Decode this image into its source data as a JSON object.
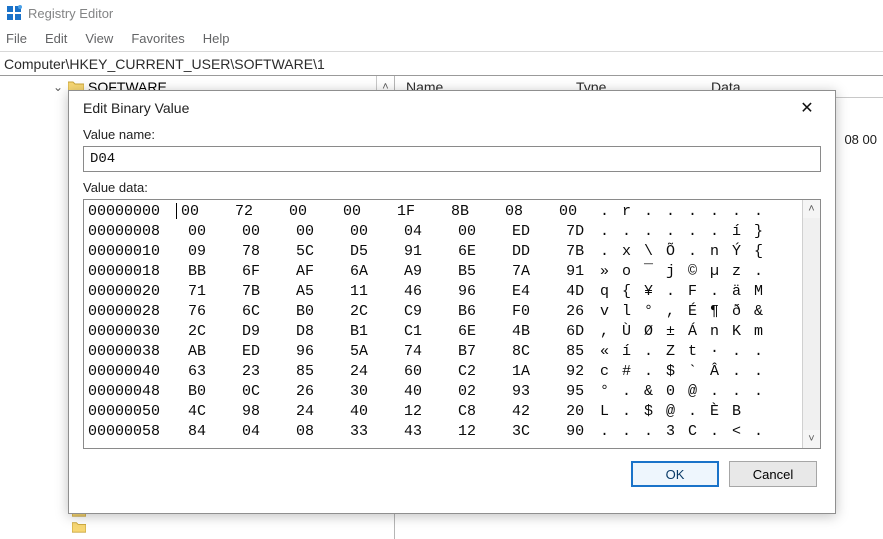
{
  "app": {
    "title": "Registry Editor"
  },
  "menu": {
    "file": "File",
    "edit": "Edit",
    "view": "View",
    "favorites": "Favorites",
    "help": "Help"
  },
  "address": {
    "path": "Computer\\HKEY_CURRENT_USER\\SOFTWARE\\1"
  },
  "tree": {
    "selected_label": "SOFTWARE"
  },
  "list": {
    "col_name": "Name",
    "col_type": "Type",
    "col_data": "Data",
    "extra_data": "08 00"
  },
  "dialog": {
    "title": "Edit Binary Value",
    "value_name_label": "Value name:",
    "value_name": "D04",
    "value_data_label": "Value data:",
    "ok": "OK",
    "cancel": "Cancel",
    "hex_rows": [
      {
        "offset": "00000000",
        "bytes": [
          "00",
          "72",
          "00",
          "00",
          "1F",
          "8B",
          "08",
          "00"
        ],
        "ascii": ". r . . . . . ."
      },
      {
        "offset": "00000008",
        "bytes": [
          "00",
          "00",
          "00",
          "00",
          "04",
          "00",
          "ED",
          "7D"
        ],
        "ascii": ". . . . . . í }"
      },
      {
        "offset": "00000010",
        "bytes": [
          "09",
          "78",
          "5C",
          "D5",
          "91",
          "6E",
          "DD",
          "7B"
        ],
        "ascii": ". x \\ Õ . n Ý {"
      },
      {
        "offset": "00000018",
        "bytes": [
          "BB",
          "6F",
          "AF",
          "6A",
          "A9",
          "B5",
          "7A",
          "91"
        ],
        "ascii": "» o ¯ j © µ z ."
      },
      {
        "offset": "00000020",
        "bytes": [
          "71",
          "7B",
          "A5",
          "11",
          "46",
          "96",
          "E4",
          "4D"
        ],
        "ascii": "q { ¥ . F . ä M"
      },
      {
        "offset": "00000028",
        "bytes": [
          "76",
          "6C",
          "B0",
          "2C",
          "C9",
          "B6",
          "F0",
          "26"
        ],
        "ascii": "v l ° , É ¶ ð &"
      },
      {
        "offset": "00000030",
        "bytes": [
          "2C",
          "D9",
          "D8",
          "B1",
          "C1",
          "6E",
          "4B",
          "6D"
        ],
        "ascii": ", Ù Ø ± Á n K m"
      },
      {
        "offset": "00000038",
        "bytes": [
          "AB",
          "ED",
          "96",
          "5A",
          "74",
          "B7",
          "8C",
          "85"
        ],
        "ascii": "« í . Z t · . ."
      },
      {
        "offset": "00000040",
        "bytes": [
          "63",
          "23",
          "85",
          "24",
          "60",
          "C2",
          "1A",
          "92"
        ],
        "ascii": "c # . $ ` Â . ."
      },
      {
        "offset": "00000048",
        "bytes": [
          "B0",
          "0C",
          "26",
          "30",
          "40",
          "02",
          "93",
          "95"
        ],
        "ascii": "° . & 0 @ . . ."
      },
      {
        "offset": "00000050",
        "bytes": [
          "4C",
          "98",
          "24",
          "40",
          "12",
          "C8",
          "42",
          "20"
        ],
        "ascii": "L . $ @ . È B  "
      },
      {
        "offset": "00000058",
        "bytes": [
          "84",
          "04",
          "08",
          "33",
          "43",
          "12",
          "3C",
          "90"
        ],
        "ascii": ". . . 3 C . < ."
      }
    ]
  }
}
